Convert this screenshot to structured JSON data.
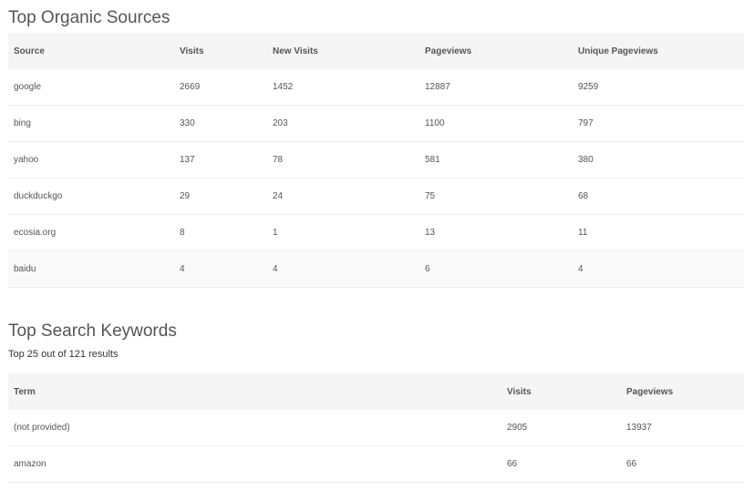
{
  "organic": {
    "title": "Top Organic Sources",
    "columns": [
      "Source",
      "Visits",
      "New Visits",
      "Pageviews",
      "Unique Pageviews"
    ],
    "rows": [
      [
        "google",
        "2669",
        "1452",
        "12887",
        "9259"
      ],
      [
        "bing",
        "330",
        "203",
        "1100",
        "797"
      ],
      [
        "yahoo",
        "137",
        "78",
        "581",
        "380"
      ],
      [
        "duckduckgo",
        "29",
        "24",
        "75",
        "68"
      ],
      [
        "ecosia.org",
        "8",
        "1",
        "13",
        "11"
      ],
      [
        "baidu",
        "4",
        "4",
        "6",
        "4"
      ]
    ]
  },
  "keywords": {
    "title": "Top Search Keywords",
    "subtitle": "Top 25 out of 121 results",
    "columns": [
      "Term",
      "Visits",
      "Pageviews"
    ],
    "rows": [
      [
        "(not provided)",
        "2905",
        "13937"
      ],
      [
        "amazon",
        "66",
        "66"
      ]
    ]
  }
}
